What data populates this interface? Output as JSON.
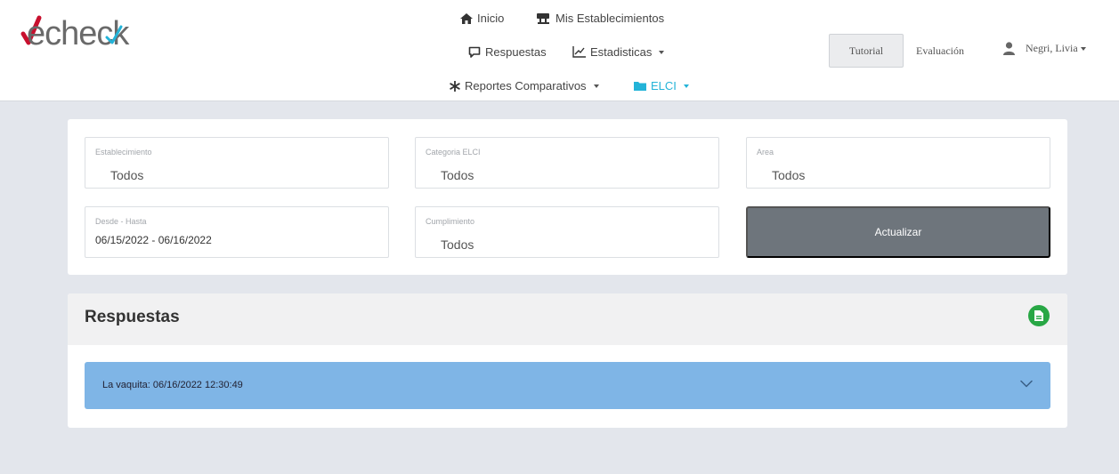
{
  "brand": {
    "name": "echeck"
  },
  "nav": {
    "inicio": "Inicio",
    "mis_establecimientos": "Mis Establecimientos",
    "respuestas": "Respuestas",
    "estadisticas": "Estadisticas",
    "reportes": "Reportes Comparativos",
    "elci": "ELCI"
  },
  "header": {
    "tutorial": "Tutorial",
    "evaluacion": "Evaluación",
    "user": "Negri, Livia"
  },
  "filters": {
    "establecimiento": {
      "label": "Establecimiento",
      "value": "Todos"
    },
    "categoria": {
      "label": "Categoria ELCI",
      "value": "Todos"
    },
    "area": {
      "label": "Area",
      "value": "Todos"
    },
    "fecha": {
      "label": "Desde - Hasta",
      "value": "06/15/2022 - 06/16/2022"
    },
    "cumplimiento": {
      "label": "Cumplimiento",
      "value": "Todos"
    },
    "update_label": "Actualizar"
  },
  "results": {
    "title": "Respuestas",
    "rows": [
      {
        "label": "La vaquita: 06/16/2022 12:30:49"
      }
    ]
  },
  "colors": {
    "accent_elci": "#23b3d8",
    "logo_red": "#c8102e",
    "row_blue": "#7fb5e6",
    "export_green": "#28a745",
    "update_button": "#6e757c"
  },
  "icons": {
    "inicio": "home-icon",
    "mis_establecimientos": "store-icon",
    "respuestas": "comment-icon",
    "estadisticas": "chart-icon",
    "reportes": "asterisk-icon",
    "elci": "folder-icon",
    "user": "user-icon",
    "export": "file-icon",
    "expand": "chevron-down-icon"
  }
}
